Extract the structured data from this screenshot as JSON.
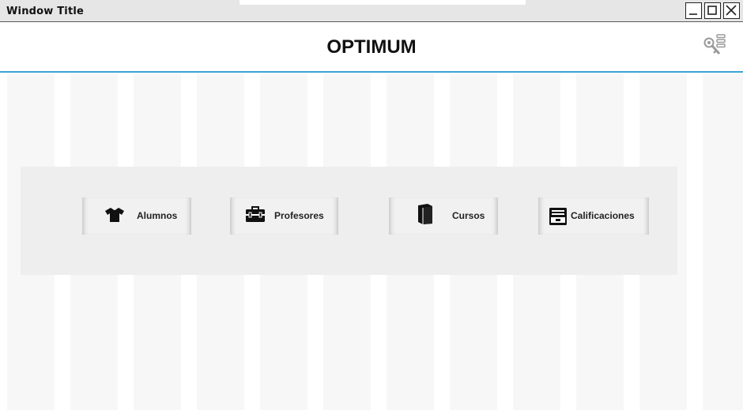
{
  "window": {
    "title": "Window Title",
    "controls": [
      "minimize",
      "maximize",
      "close"
    ]
  },
  "header": {
    "app_title": "OPTIMUM",
    "user_menu_icon": "key-menu-icon"
  },
  "menu": {
    "items": [
      {
        "label": "Alumnos",
        "icon": "shirt-icon"
      },
      {
        "label": "Profesores",
        "icon": "toolbox-icon"
      },
      {
        "label": "Cursos",
        "icon": "book-icon"
      },
      {
        "label": "Calificaciones",
        "icon": "inbox-tray-icon"
      }
    ]
  },
  "colors": {
    "accent": "#3aa3d6",
    "panel": "#eeeeee",
    "column": "#f7f7f7"
  }
}
